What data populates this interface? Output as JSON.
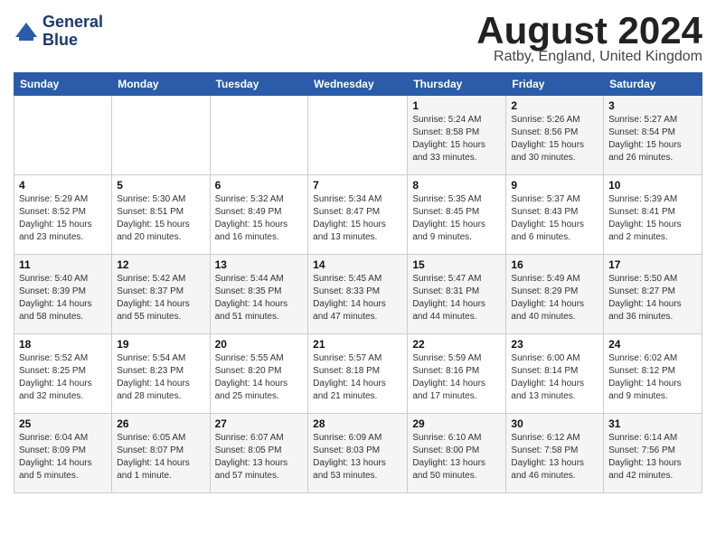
{
  "header": {
    "logo_line1": "General",
    "logo_line2": "Blue",
    "month": "August 2024",
    "location": "Ratby, England, United Kingdom"
  },
  "weekdays": [
    "Sunday",
    "Monday",
    "Tuesday",
    "Wednesday",
    "Thursday",
    "Friday",
    "Saturday"
  ],
  "weeks": [
    [
      {
        "day": "",
        "info": ""
      },
      {
        "day": "",
        "info": ""
      },
      {
        "day": "",
        "info": ""
      },
      {
        "day": "",
        "info": ""
      },
      {
        "day": "1",
        "info": "Sunrise: 5:24 AM\nSunset: 8:58 PM\nDaylight: 15 hours\nand 33 minutes."
      },
      {
        "day": "2",
        "info": "Sunrise: 5:26 AM\nSunset: 8:56 PM\nDaylight: 15 hours\nand 30 minutes."
      },
      {
        "day": "3",
        "info": "Sunrise: 5:27 AM\nSunset: 8:54 PM\nDaylight: 15 hours\nand 26 minutes."
      }
    ],
    [
      {
        "day": "4",
        "info": "Sunrise: 5:29 AM\nSunset: 8:52 PM\nDaylight: 15 hours\nand 23 minutes."
      },
      {
        "day": "5",
        "info": "Sunrise: 5:30 AM\nSunset: 8:51 PM\nDaylight: 15 hours\nand 20 minutes."
      },
      {
        "day": "6",
        "info": "Sunrise: 5:32 AM\nSunset: 8:49 PM\nDaylight: 15 hours\nand 16 minutes."
      },
      {
        "day": "7",
        "info": "Sunrise: 5:34 AM\nSunset: 8:47 PM\nDaylight: 15 hours\nand 13 minutes."
      },
      {
        "day": "8",
        "info": "Sunrise: 5:35 AM\nSunset: 8:45 PM\nDaylight: 15 hours\nand 9 minutes."
      },
      {
        "day": "9",
        "info": "Sunrise: 5:37 AM\nSunset: 8:43 PM\nDaylight: 15 hours\nand 6 minutes."
      },
      {
        "day": "10",
        "info": "Sunrise: 5:39 AM\nSunset: 8:41 PM\nDaylight: 15 hours\nand 2 minutes."
      }
    ],
    [
      {
        "day": "11",
        "info": "Sunrise: 5:40 AM\nSunset: 8:39 PM\nDaylight: 14 hours\nand 58 minutes."
      },
      {
        "day": "12",
        "info": "Sunrise: 5:42 AM\nSunset: 8:37 PM\nDaylight: 14 hours\nand 55 minutes."
      },
      {
        "day": "13",
        "info": "Sunrise: 5:44 AM\nSunset: 8:35 PM\nDaylight: 14 hours\nand 51 minutes."
      },
      {
        "day": "14",
        "info": "Sunrise: 5:45 AM\nSunset: 8:33 PM\nDaylight: 14 hours\nand 47 minutes."
      },
      {
        "day": "15",
        "info": "Sunrise: 5:47 AM\nSunset: 8:31 PM\nDaylight: 14 hours\nand 44 minutes."
      },
      {
        "day": "16",
        "info": "Sunrise: 5:49 AM\nSunset: 8:29 PM\nDaylight: 14 hours\nand 40 minutes."
      },
      {
        "day": "17",
        "info": "Sunrise: 5:50 AM\nSunset: 8:27 PM\nDaylight: 14 hours\nand 36 minutes."
      }
    ],
    [
      {
        "day": "18",
        "info": "Sunrise: 5:52 AM\nSunset: 8:25 PM\nDaylight: 14 hours\nand 32 minutes."
      },
      {
        "day": "19",
        "info": "Sunrise: 5:54 AM\nSunset: 8:23 PM\nDaylight: 14 hours\nand 28 minutes."
      },
      {
        "day": "20",
        "info": "Sunrise: 5:55 AM\nSunset: 8:20 PM\nDaylight: 14 hours\nand 25 minutes."
      },
      {
        "day": "21",
        "info": "Sunrise: 5:57 AM\nSunset: 8:18 PM\nDaylight: 14 hours\nand 21 minutes."
      },
      {
        "day": "22",
        "info": "Sunrise: 5:59 AM\nSunset: 8:16 PM\nDaylight: 14 hours\nand 17 minutes."
      },
      {
        "day": "23",
        "info": "Sunrise: 6:00 AM\nSunset: 8:14 PM\nDaylight: 14 hours\nand 13 minutes."
      },
      {
        "day": "24",
        "info": "Sunrise: 6:02 AM\nSunset: 8:12 PM\nDaylight: 14 hours\nand 9 minutes."
      }
    ],
    [
      {
        "day": "25",
        "info": "Sunrise: 6:04 AM\nSunset: 8:09 PM\nDaylight: 14 hours\nand 5 minutes."
      },
      {
        "day": "26",
        "info": "Sunrise: 6:05 AM\nSunset: 8:07 PM\nDaylight: 14 hours\nand 1 minute."
      },
      {
        "day": "27",
        "info": "Sunrise: 6:07 AM\nSunset: 8:05 PM\nDaylight: 13 hours\nand 57 minutes."
      },
      {
        "day": "28",
        "info": "Sunrise: 6:09 AM\nSunset: 8:03 PM\nDaylight: 13 hours\nand 53 minutes."
      },
      {
        "day": "29",
        "info": "Sunrise: 6:10 AM\nSunset: 8:00 PM\nDaylight: 13 hours\nand 50 minutes."
      },
      {
        "day": "30",
        "info": "Sunrise: 6:12 AM\nSunset: 7:58 PM\nDaylight: 13 hours\nand 46 minutes."
      },
      {
        "day": "31",
        "info": "Sunrise: 6:14 AM\nSunset: 7:56 PM\nDaylight: 13 hours\nand 42 minutes."
      }
    ]
  ]
}
